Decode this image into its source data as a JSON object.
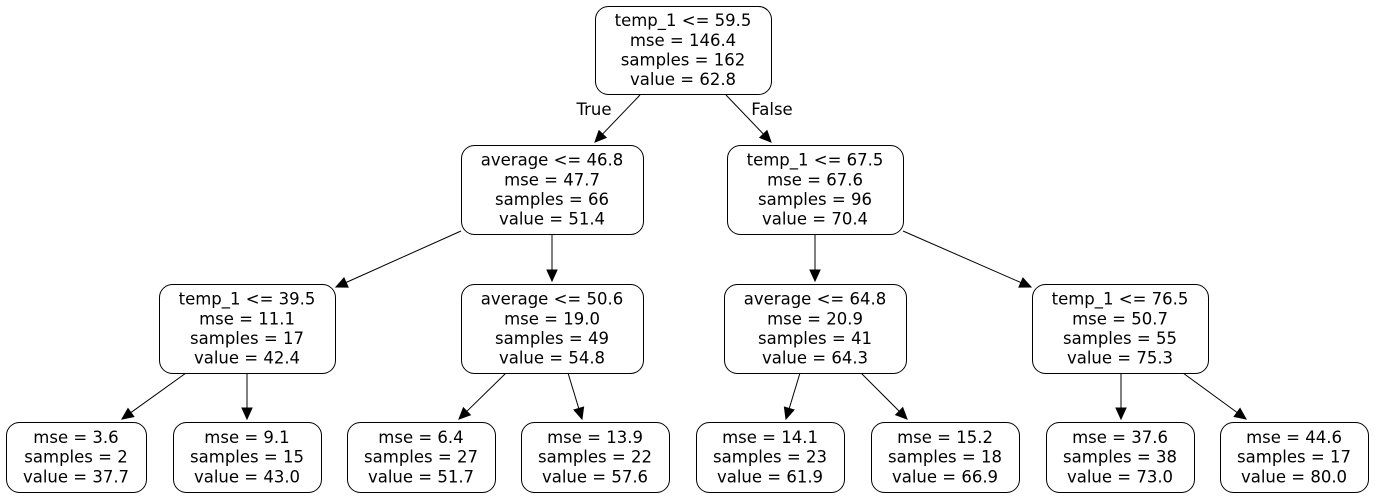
{
  "tree": {
    "nodes": {
      "n0": {
        "lines": [
          "temp_1 <= 59.5",
          "mse = 146.4",
          "samples = 162",
          "value = 62.8"
        ]
      },
      "n1": {
        "lines": [
          "average <= 46.8",
          "mse = 47.7",
          "samples = 66",
          "value = 51.4"
        ]
      },
      "n2": {
        "lines": [
          "temp_1 <= 67.5",
          "mse = 67.6",
          "samples = 96",
          "value = 70.4"
        ]
      },
      "n3": {
        "lines": [
          "temp_1 <= 39.5",
          "mse = 11.1",
          "samples = 17",
          "value = 42.4"
        ]
      },
      "n4": {
        "lines": [
          "average <= 50.6",
          "mse = 19.0",
          "samples = 49",
          "value = 54.8"
        ]
      },
      "n5": {
        "lines": [
          "average <= 64.8",
          "mse = 20.9",
          "samples = 41",
          "value = 64.3"
        ]
      },
      "n6": {
        "lines": [
          "temp_1 <= 76.5",
          "mse = 50.7",
          "samples = 55",
          "value = 75.3"
        ]
      },
      "n7": {
        "lines": [
          "mse = 3.6",
          "samples = 2",
          "value = 37.7"
        ]
      },
      "n8": {
        "lines": [
          "mse = 9.1",
          "samples = 15",
          "value = 43.0"
        ]
      },
      "n9": {
        "lines": [
          "mse = 6.4",
          "samples = 27",
          "value = 51.7"
        ]
      },
      "n10": {
        "lines": [
          "mse = 13.9",
          "samples = 22",
          "value = 57.6"
        ]
      },
      "n11": {
        "lines": [
          "mse = 14.1",
          "samples = 23",
          "value = 61.9"
        ]
      },
      "n12": {
        "lines": [
          "mse = 15.2",
          "samples = 18",
          "value = 66.9"
        ]
      },
      "n13": {
        "lines": [
          "mse = 37.6",
          "samples = 38",
          "value = 73.0"
        ]
      },
      "n14": {
        "lines": [
          "mse = 44.6",
          "samples = 17",
          "value = 80.0"
        ]
      }
    },
    "edges": [
      {
        "from": "n0",
        "to": "n1",
        "label": "True"
      },
      {
        "from": "n0",
        "to": "n2",
        "label": "False"
      },
      {
        "from": "n1",
        "to": "n3"
      },
      {
        "from": "n1",
        "to": "n4"
      },
      {
        "from": "n2",
        "to": "n5"
      },
      {
        "from": "n2",
        "to": "n6"
      },
      {
        "from": "n3",
        "to": "n7"
      },
      {
        "from": "n3",
        "to": "n8"
      },
      {
        "from": "n4",
        "to": "n9"
      },
      {
        "from": "n4",
        "to": "n10"
      },
      {
        "from": "n5",
        "to": "n11"
      },
      {
        "from": "n5",
        "to": "n12"
      },
      {
        "from": "n6",
        "to": "n13"
      },
      {
        "from": "n6",
        "to": "n14"
      }
    ]
  }
}
